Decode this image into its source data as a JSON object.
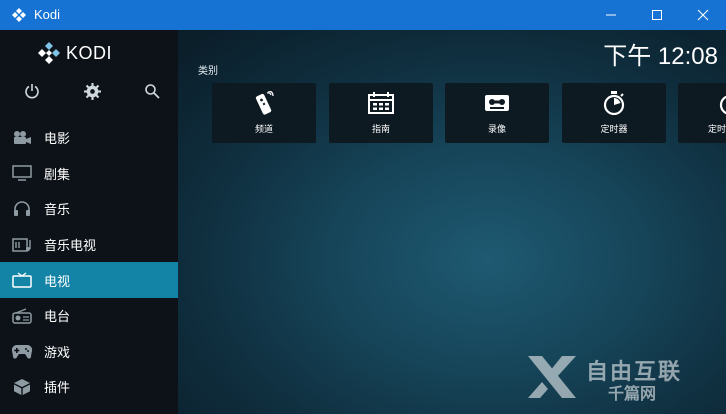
{
  "window": {
    "title": "Kodi"
  },
  "logo": {
    "text": "KODI"
  },
  "quick_actions": [
    "power-icon",
    "gear-icon",
    "search-icon"
  ],
  "menu": [
    {
      "label": "电影",
      "icon": "movie-camera-icon"
    },
    {
      "label": "剧集",
      "icon": "monitor-icon"
    },
    {
      "label": "音乐",
      "icon": "headphones-icon"
    },
    {
      "label": "音乐电视",
      "icon": "music-video-icon"
    },
    {
      "label": "电视",
      "icon": "tv-icon",
      "active": true
    },
    {
      "label": "电台",
      "icon": "radio-icon"
    },
    {
      "label": "游戏",
      "icon": "gamepad-icon"
    },
    {
      "label": "插件",
      "icon": "box-icon"
    }
  ],
  "clock": "下午 12:08",
  "section": {
    "title": "类别"
  },
  "tiles": [
    {
      "label": "频道",
      "icon": "remote-icon"
    },
    {
      "label": "指南",
      "icon": "guide-icon"
    },
    {
      "label": "录像",
      "icon": "tape-icon"
    },
    {
      "label": "定时器",
      "icon": "timer-icon"
    },
    {
      "label": "定时",
      "icon": "timer-icon"
    }
  ],
  "watermark": {
    "text": "自由互联",
    "sub": "千篇网"
  },
  "colors": {
    "titlebar": "#1673d3",
    "active_item": "#1383a6",
    "sidebar": "#0c1218"
  }
}
